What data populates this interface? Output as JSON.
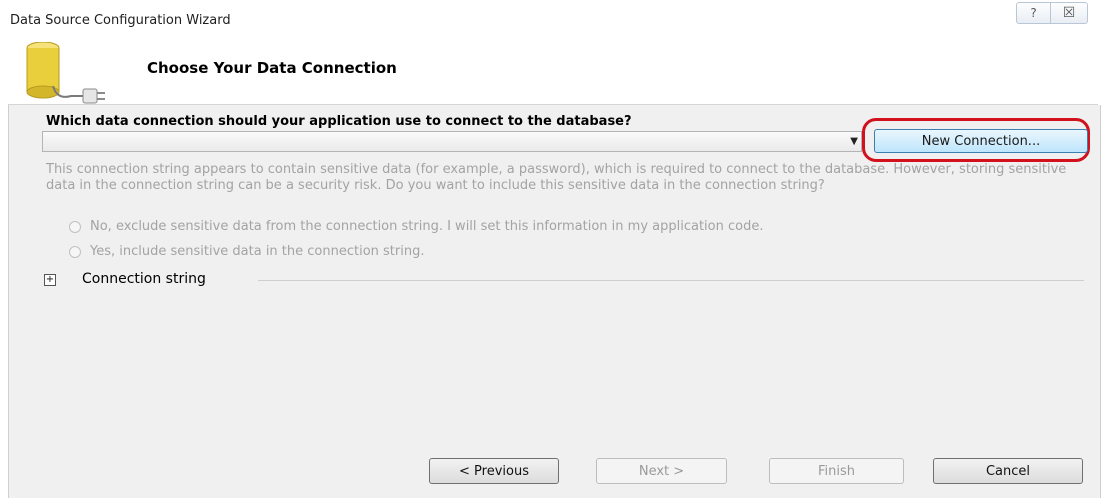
{
  "window": {
    "title": "Data Source Configuration Wizard",
    "help_glyph": "?",
    "close_glyph": "☒"
  },
  "header": {
    "title": "Choose Your Data Connection",
    "icon": "database-plug-icon"
  },
  "connection": {
    "question": "Which data connection should your application use to connect to the database?",
    "selected_value": "",
    "new_connection_label": "New Connection...",
    "highlight_color": "#d1121d"
  },
  "sensitive": {
    "text": "This connection string appears to contain sensitive data (for example, a password), which is required to connect to the database. However, storing sensitive data in the connection string can be a security risk. Do you want to include this sensitive data in the connection string?",
    "options": [
      "No, exclude sensitive data from the connection string. I will set this information in my application code.",
      "Yes, include sensitive data in the connection string."
    ]
  },
  "connection_string": {
    "expander_glyph": "+",
    "label": "Connection string"
  },
  "footer": {
    "previous_label": "< Previous",
    "next_label": "Next >",
    "finish_label": "Finish",
    "cancel_label": "Cancel"
  }
}
